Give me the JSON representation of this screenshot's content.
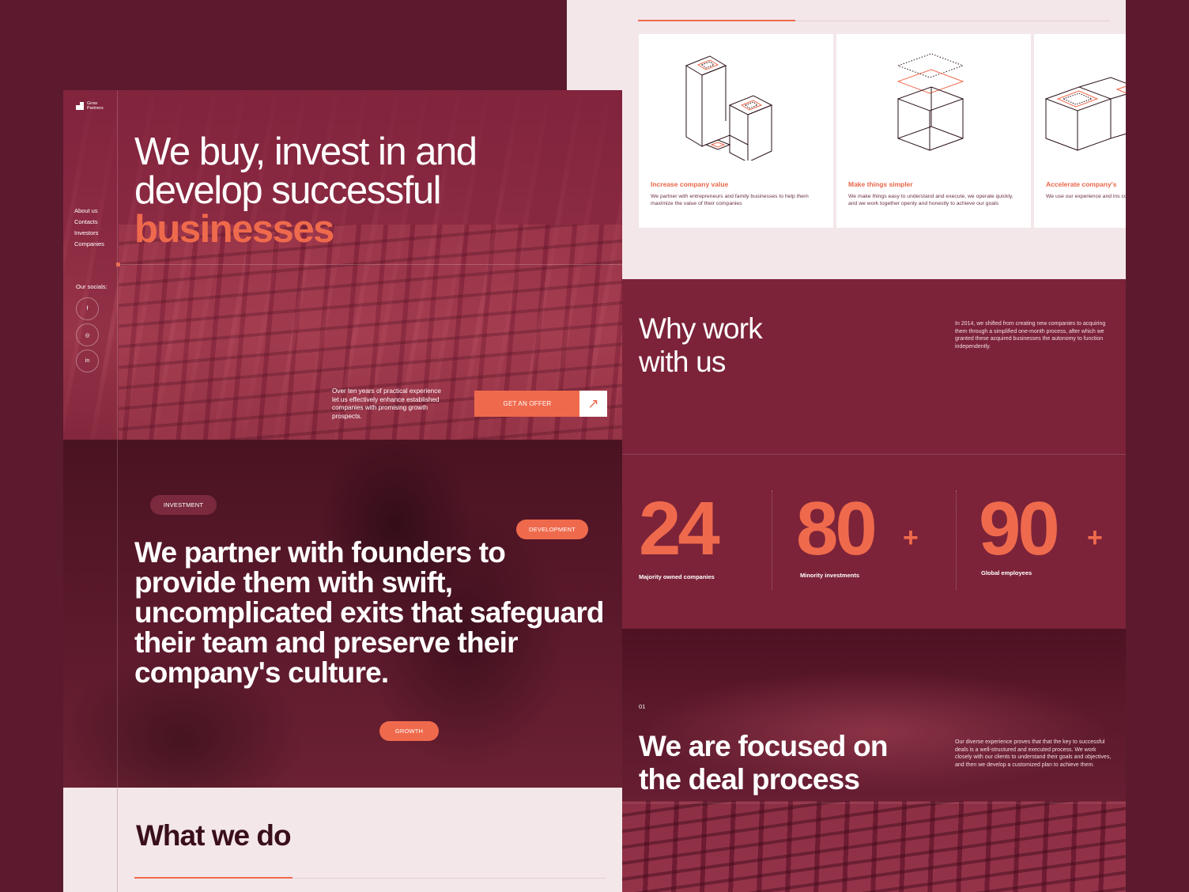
{
  "brand": {
    "name_line1": "Grow",
    "name_line2": "Partners"
  },
  "nav": {
    "items": [
      "About us",
      "Contacts",
      "Investors",
      "Companies"
    ]
  },
  "socials": {
    "label": "Our socials:",
    "icons": [
      "facebook-icon",
      "instagram-icon",
      "linkedin-icon"
    ],
    "glyphs": [
      "f",
      "◎",
      "in"
    ]
  },
  "hero": {
    "title_line1": "We buy, invest in and",
    "title_line2": "develop successful",
    "title_accent": "businesses",
    "description": "Over ten years of practical experience let us effectively enhance established companies with promising growth prospects.",
    "cta_label": "GET AN OFFER",
    "cta_arrow": "↗"
  },
  "partner": {
    "tags": [
      "INVESTMENT",
      "DEVELOPMENT",
      "GROWTH"
    ],
    "title": "We partner with founders to provide them with swift, uncomplicated exits that safeguard their team and preserve their company's culture."
  },
  "what_we_do": {
    "title": "What we do"
  },
  "cards": [
    {
      "title": "Increase company value",
      "text": "We partner with entrepreneurs and family businesses to help them maximize the value of their companies"
    },
    {
      "title": "Make things simpler",
      "text": "We make things easy to understand and execute, we operate quickly, and we work together openly and honestly to achieve our goals"
    },
    {
      "title": "Accelerate company's",
      "text": "We use our experience and ins companies accelerate their gr"
    }
  ],
  "why": {
    "title_line1": "Why work",
    "title_line2": "with us",
    "text": "In 2014, we shifted from creating new companies to acquiring them through a simplified one-month process, after which we granted these acquired businesses the autonomy to function independently."
  },
  "stats": [
    {
      "value": "24",
      "suffix": "",
      "label": "Majority owned companies"
    },
    {
      "value": "80",
      "suffix": "+",
      "label": "Minority investments"
    },
    {
      "value": "90",
      "suffix": "+",
      "label": "Global employees"
    }
  ],
  "deal": {
    "number": "01",
    "title_line1": "We are focused on",
    "title_line2": "the deal process",
    "text": "Our diverse experience proves that that the key to successful deals is a well-structured and executed process. We work closely with our clients to understand their goals and objectives, and then we develop a customized plan to achieve them."
  },
  "colors": {
    "accent": "#ef6a4c",
    "maroon": "#7c2339",
    "dark": "#5b1a2d",
    "pale": "#f3e7ea"
  }
}
